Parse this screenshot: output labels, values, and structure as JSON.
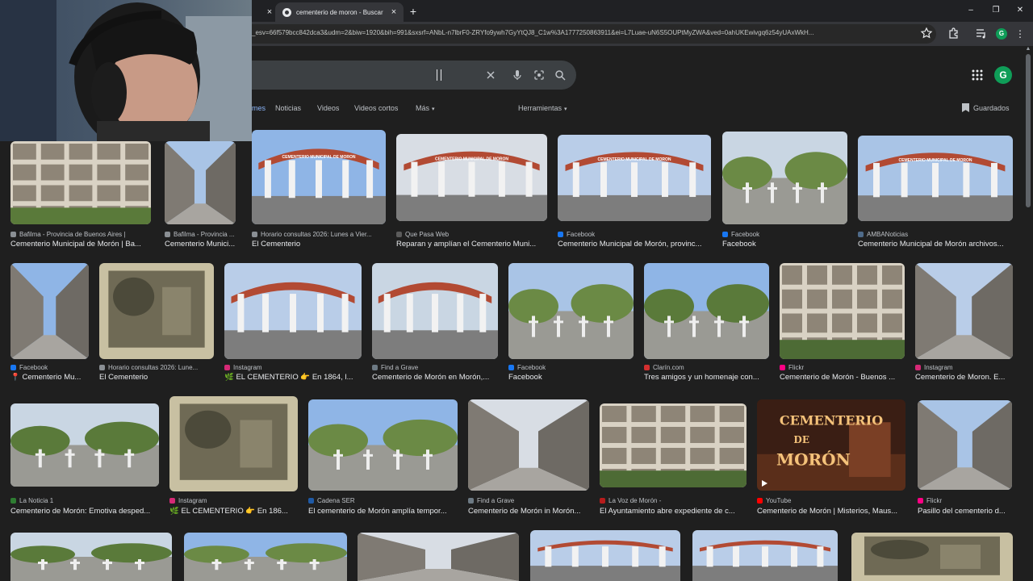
{
  "browser": {
    "tabs": [
      {
        "title": "",
        "active": false
      },
      {
        "title": "cementerio de moron - Buscar",
        "active": true
      }
    ],
    "url": "_esv=66f579bcc842dca3&udm=2&biw=1920&bih=991&sxsrf=ANbL-n7lbrF0-ZRYfo9ywh7GyYtQJ8_C1w%3A1777250863911&ei=L7Luae-uN6S5OUPtMyZWA&ved=0ahUKEwivgq6z54yUAxWkH...",
    "profile_letter": "G"
  },
  "google": {
    "avatar_letter": "G",
    "filters": [
      "mes",
      "Noticias",
      "Videos",
      "Videos cortos",
      "Más",
      "Herramientas"
    ],
    "saved_label": "Guardados"
  },
  "images": [
    {
      "source": "Bafilma - Provincia de Buenos Aires |",
      "caption": "Cementerio Municipal de Morón | Ba..."
    },
    {
      "source": "Bafilma - Provincia ...",
      "caption": "Cementerio Munici..."
    },
    {
      "source": "Horario consultas 2026: Lunes a Vier...",
      "caption": "El Cementerio"
    },
    {
      "source": "Que Pasa Web",
      "caption": "Reparan y amplían el Cementerio Muni..."
    },
    {
      "source": "Facebook",
      "caption": "Cementerio Municipal de Morón, provinc..."
    },
    {
      "source": "Facebook",
      "caption": "Facebook"
    },
    {
      "source": "AMBANoticias",
      "caption": "Cementerio Municipal de Morón archivos..."
    },
    {
      "source": "Facebook",
      "caption": "📍 Cementerio Mu..."
    },
    {
      "source": "Horario consultas 2026: Lune...",
      "caption": "El Cementerio"
    },
    {
      "source": "Instagram",
      "caption": "🌿 EL CEMENTERIO 👉 En 1864, l..."
    },
    {
      "source": "Find a Grave",
      "caption": "Cementerio de Morón en Morón,..."
    },
    {
      "source": "Facebook",
      "caption": "Facebook"
    },
    {
      "source": "Clarín.com",
      "caption": "Tres amigos y un homenaje con..."
    },
    {
      "source": "Flickr",
      "caption": "Cementerio de Morón - Buenos ..."
    },
    {
      "source": "Instagram",
      "caption": "Cementerio de Moron. E..."
    },
    {
      "source": "La Noticia 1",
      "caption": "Cementerio de Morón: Emotiva desped..."
    },
    {
      "source": "Instagram",
      "caption": "🌿 EL CEMENTERIO 👉 En 186..."
    },
    {
      "source": "Cadena SER",
      "caption": "El cementerio de Morón amplía tempor..."
    },
    {
      "source": "Find a Grave",
      "caption": "Cementerio de Morón in Morón..."
    },
    {
      "source": "La Voz de Morón -",
      "caption": "El Ayuntamiento abre expediente de c..."
    },
    {
      "source": "YouTube",
      "caption": "Cementerio de Morón | Misterios, Maus..."
    },
    {
      "source": "Flickr",
      "caption": "Pasillo del cementerio d..."
    }
  ],
  "thumb_texts": {
    "arch_sign": "CEMENTERIO MUNICIPAL DE MORON",
    "youtube_title_1": "CEMENTERIO",
    "youtube_title_2": "DE",
    "youtube_title_3": "MORÓN"
  },
  "colors": {
    "background": "#1f1f1f",
    "link_blue": "#8ab4f8",
    "text_secondary": "#bdc1c6",
    "avatar_green": "#0f9d58"
  },
  "icons": [
    "search-icon",
    "mic-icon",
    "lens-icon",
    "clear-icon",
    "apps-icon",
    "star-icon",
    "extension-icon",
    "bookmark-icon"
  ]
}
